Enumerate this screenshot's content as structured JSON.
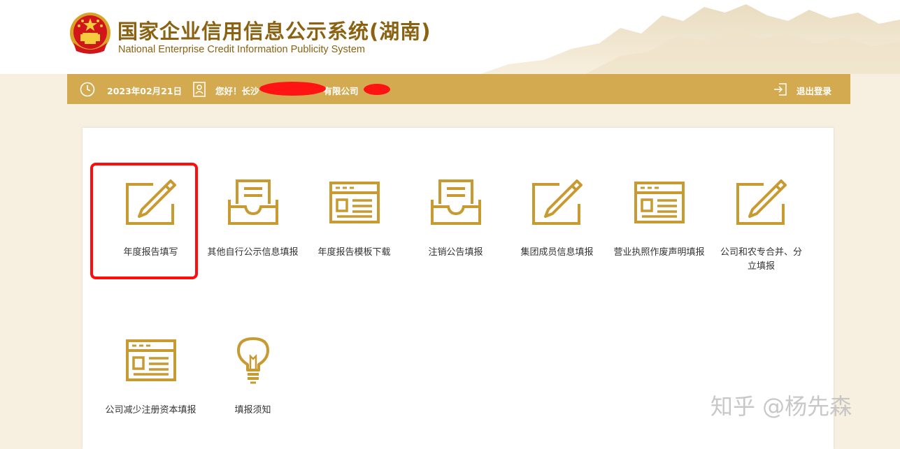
{
  "header": {
    "title_cn": "国家企业信用信息公示系统(湖南)",
    "title_en": "National Enterprise Credit Information Publicity System"
  },
  "info_bar": {
    "date": "2023年02月21日",
    "greeting_prefix": "您好！长沙",
    "greeting_suffix": "有限公司",
    "logout_label": "退出登录",
    "icons": [
      "clock-icon",
      "user-card-icon",
      "logout-icon"
    ]
  },
  "tiles": [
    {
      "label": "年度报告填写",
      "icon": "pencil-edit-icon",
      "highlighted": true
    },
    {
      "label": "其他自行公示信息填报",
      "icon": "inbox-tray-icon"
    },
    {
      "label": "年度报告模板下载",
      "icon": "form-window-icon"
    },
    {
      "label": "注销公告填报",
      "icon": "inbox-tray-icon"
    },
    {
      "label": "集团成员信息填报",
      "icon": "pencil-edit-icon"
    },
    {
      "label": "营业执照作废声明填报",
      "icon": "form-window-icon"
    },
    {
      "label": "公司和农专合并、分立填报",
      "icon": "pencil-edit-icon"
    },
    {
      "label": "公司减少注册资本填报",
      "icon": "form-window-icon"
    },
    {
      "label": "填报须知",
      "icon": "lightbulb-icon"
    }
  ],
  "colors": {
    "gold": "#c79a32",
    "bar": "#d4aa50",
    "title": "#8a6212",
    "highlight": "#ff0c0c"
  },
  "watermark": "知乎 @杨先森"
}
